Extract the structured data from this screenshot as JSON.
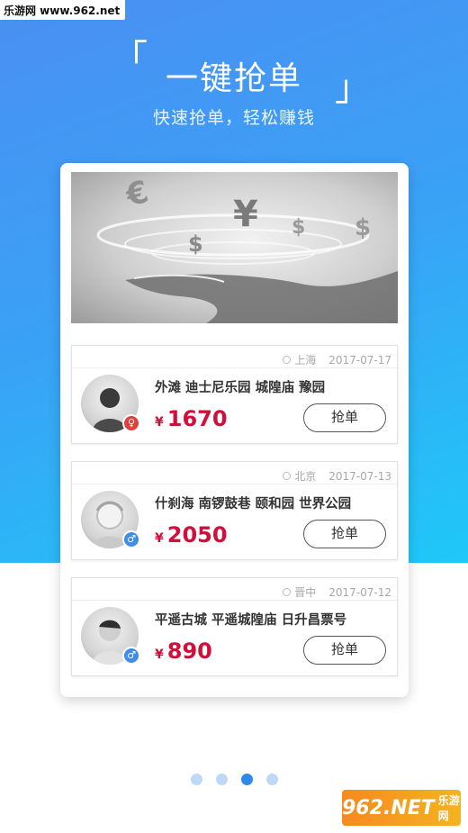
{
  "watermark": "乐游网 www.962.net",
  "hero": {
    "bracket_open": "「",
    "title": "一键抢单",
    "bracket_close": "」",
    "subtitle": "快速抢单，轻松赚钱"
  },
  "orders": [
    {
      "city": "上海",
      "date": "2017-07-17",
      "places": "外滩  迪士尼乐园  城隍庙  豫园",
      "currency": "¥",
      "amount": "1670",
      "gender": "female",
      "gender_symbol": "♀",
      "button": "抢单"
    },
    {
      "city": "北京",
      "date": "2017-07-13",
      "places": "什刹海  南锣鼓巷  颐和园  世界公园",
      "currency": "¥",
      "amount": "2050",
      "gender": "male",
      "gender_symbol": "♂",
      "button": "抢单"
    },
    {
      "city": "晋中",
      "date": "2017-07-12",
      "places": "平遥古城  平遥城隍庙  日升昌票号",
      "currency": "¥",
      "amount": "890",
      "gender": "male",
      "gender_symbol": "♂",
      "button": "抢单"
    }
  ],
  "pagination": {
    "total": 4,
    "active_index": 2
  },
  "brand": {
    "logo_main": "962.NET",
    "logo_sub": "乐游网"
  },
  "colors": {
    "accent": "#2d8ae6",
    "price": "#d0103a",
    "female": "#e0403a",
    "male": "#3f8de5"
  }
}
